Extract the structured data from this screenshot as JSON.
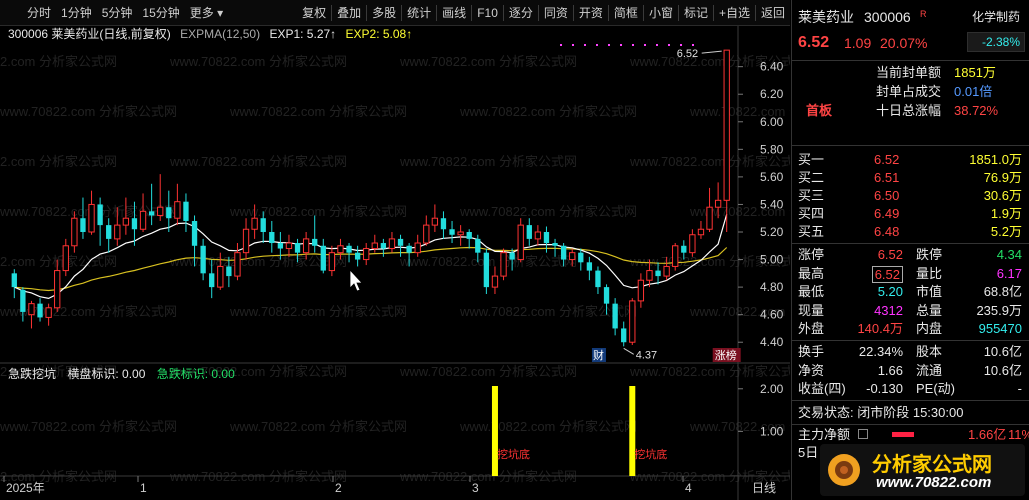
{
  "toolbar": {
    "left": [
      "分时",
      "1分钟",
      "5分钟",
      "15分钟",
      "更多"
    ],
    "right": [
      "复权",
      "叠加",
      "多股",
      "统计",
      "画线",
      "F10",
      "逐分",
      "同资",
      "开资",
      "简框",
      "小窗",
      "标记",
      "+自选",
      "返回"
    ]
  },
  "header": {
    "code_name": "300006 莱美药业(日线,前复权)",
    "indicator": "EXPMA(12,50)",
    "exp1": "EXP1: 5.27↑",
    "exp2": "EXP2: 5.08↑"
  },
  "sub_indicator": {
    "name": "急跌挖坑",
    "label1": "横盘标识: 0.00",
    "label2": "急跌标识: 0.00",
    "marks": [
      "挖坑底",
      "挖坑底"
    ]
  },
  "price_axis": [
    "6.40",
    "6.20",
    "6.00",
    "5.80",
    "5.60",
    "5.40",
    "5.20",
    "5.00",
    "4.80",
    "4.60",
    "4.40"
  ],
  "sub_axis": [
    "2.00",
    "1.00"
  ],
  "x_axis": [
    "2025年",
    "1",
    "2",
    "3",
    "4"
  ],
  "x_axis_right": "日线",
  "annotations": {
    "high": "6.52",
    "low": "4.37",
    "cai": "财",
    "zhangbang": "涨榜"
  },
  "panel": {
    "name": "莱美药业",
    "code": "300006",
    "r_badge": "R",
    "sector": "化学制药",
    "sector_change": "-2.38%",
    "price": "6.52",
    "change": "1.09",
    "pct": "20.07%",
    "tag": "首板",
    "seal_rows": [
      {
        "label": "当前封单额",
        "value": "1851万"
      },
      {
        "label": "封单占成交",
        "value": "0.01倍"
      },
      {
        "label": "十日总涨幅",
        "value": "38.72%"
      }
    ],
    "bids": [
      {
        "label": "买一",
        "price": "6.52",
        "vol": "1851.0万"
      },
      {
        "label": "买二",
        "price": "6.51",
        "vol": "76.9万"
      },
      {
        "label": "买三",
        "price": "6.50",
        "vol": "30.6万"
      },
      {
        "label": "买四",
        "price": "6.49",
        "vol": "1.9万"
      },
      {
        "label": "买五",
        "price": "6.48",
        "vol": "5.2万"
      }
    ],
    "stats": [
      {
        "l1": "涨停",
        "v1": "6.52",
        "l2": "跌停",
        "v2": "4.34"
      },
      {
        "l1": "最高",
        "v1": "6.52",
        "l2": "量比",
        "v2": "6.17"
      },
      {
        "l1": "最低",
        "v1": "5.20",
        "l2": "市值",
        "v2": "68.8亿"
      },
      {
        "l1": "现量",
        "v1": "4312",
        "l2": "总量",
        "v2": "235.9万"
      },
      {
        "l1": "外盘",
        "v1": "140.4万",
        "l2": "内盘",
        "v2": "955470"
      }
    ],
    "stats2": [
      {
        "l1": "换手",
        "v1": "22.34%",
        "l2": "股本",
        "v2": "10.6亿"
      },
      {
        "l1": "净资",
        "v1": "1.66",
        "l2": "流通",
        "v2": "10.6亿"
      },
      {
        "l1": "收益(四)",
        "v1": "-0.130",
        "l2": "PE(动)",
        "v2": "-"
      }
    ],
    "trade_status": "交易状态: 闭市阶段 15:30:00",
    "main_flow_label": "主力净额",
    "main_flow_value": "1.66亿",
    "main_flow_pct": "11%",
    "day5": "5日"
  },
  "watermark": "www.70822.com 分析家公式网",
  "logo": {
    "title": "分析家公式网",
    "url": "www.70822.com"
  },
  "chart_data": {
    "type": "candlestick",
    "title": "300006 莱美药业(日线,前复权)",
    "x_ticks": [
      "2025年",
      "1",
      "2",
      "3",
      "4"
    ],
    "ylim": [
      4.3,
      6.55
    ],
    "candles": [
      [
        4.9,
        4.8,
        4.93,
        4.72
      ],
      [
        4.78,
        4.62,
        4.8,
        4.55
      ],
      [
        4.6,
        4.68,
        4.7,
        4.5
      ],
      [
        4.68,
        4.58,
        4.72,
        4.55
      ],
      [
        4.58,
        4.65,
        4.68,
        4.52
      ],
      [
        4.65,
        4.92,
        5.0,
        4.62
      ],
      [
        4.92,
        5.1,
        5.15,
        4.88
      ],
      [
        5.1,
        5.3,
        5.35,
        5.05
      ],
      [
        5.3,
        5.2,
        5.45,
        5.15
      ],
      [
        5.2,
        5.4,
        5.5,
        5.18
      ],
      [
        5.4,
        5.25,
        5.45,
        5.1
      ],
      [
        5.25,
        5.15,
        5.3,
        5.05
      ],
      [
        5.15,
        5.25,
        5.38,
        5.1
      ],
      [
        5.25,
        5.3,
        5.45,
        5.18
      ],
      [
        5.3,
        5.22,
        5.42,
        5.1
      ],
      [
        5.22,
        5.35,
        5.48,
        5.2
      ],
      [
        5.35,
        5.32,
        5.55,
        5.25
      ],
      [
        5.32,
        5.38,
        5.62,
        5.28
      ],
      [
        5.38,
        5.3,
        5.5,
        5.2
      ],
      [
        5.3,
        5.42,
        5.55,
        5.25
      ],
      [
        5.42,
        5.28,
        5.48,
        5.2
      ],
      [
        5.28,
        5.1,
        5.32,
        4.95
      ],
      [
        5.1,
        4.9,
        5.15,
        4.85
      ],
      [
        4.9,
        4.8,
        5.0,
        4.72
      ],
      [
        4.8,
        4.95,
        5.05,
        4.78
      ],
      [
        4.95,
        4.88,
        5.02,
        4.8
      ],
      [
        4.88,
        5.05,
        5.12,
        4.85
      ],
      [
        5.05,
        5.22,
        5.3,
        5.0
      ],
      [
        5.22,
        5.3,
        5.4,
        5.15
      ],
      [
        5.3,
        5.2,
        5.35,
        5.12
      ],
      [
        5.2,
        5.12,
        5.28,
        5.05
      ],
      [
        5.12,
        5.08,
        5.2,
        5.0
      ],
      [
        5.08,
        5.12,
        5.18,
        5.02
      ],
      [
        5.12,
        5.05,
        5.15,
        4.98
      ],
      [
        5.05,
        5.15,
        5.2,
        5.0
      ],
      [
        5.15,
        5.1,
        5.32,
        5.05
      ],
      [
        5.1,
        4.92,
        5.15,
        4.9
      ],
      [
        4.92,
        5.05,
        5.1,
        4.88
      ],
      [
        5.05,
        5.1,
        5.15,
        5.0
      ],
      [
        5.1,
        5.05,
        5.12,
        4.98
      ],
      [
        5.05,
        5.0,
        5.1,
        4.95
      ],
      [
        5.0,
        5.08,
        5.12,
        4.96
      ],
      [
        5.08,
        5.12,
        5.18,
        5.05
      ],
      [
        5.12,
        5.08,
        5.15,
        5.02
      ],
      [
        5.08,
        5.15,
        5.2,
        5.05
      ],
      [
        5.15,
        5.1,
        5.18,
        5.02
      ],
      [
        5.1,
        5.05,
        5.12,
        4.95
      ],
      [
        5.05,
        5.12,
        5.18,
        5.02
      ],
      [
        5.12,
        5.25,
        5.32,
        5.1
      ],
      [
        5.25,
        5.3,
        5.4,
        5.2
      ],
      [
        5.3,
        5.22,
        5.35,
        5.15
      ],
      [
        5.22,
        5.18,
        5.28,
        5.12
      ],
      [
        5.18,
        5.2,
        5.25,
        5.1
      ],
      [
        5.2,
        5.15,
        5.22,
        5.08
      ],
      [
        5.15,
        5.05,
        5.18,
        4.98
      ],
      [
        5.05,
        4.8,
        5.08,
        4.75
      ],
      [
        4.8,
        4.88,
        4.95,
        4.75
      ],
      [
        4.88,
        5.05,
        5.08,
        4.85
      ],
      [
        5.05,
        5.0,
        5.08,
        4.92
      ],
      [
        5.0,
        5.25,
        5.3,
        4.98
      ],
      [
        5.25,
        5.15,
        5.3,
        5.1
      ],
      [
        5.15,
        5.2,
        5.25,
        5.1
      ],
      [
        5.2,
        5.12,
        5.24,
        5.05
      ],
      [
        5.12,
        5.1,
        5.15,
        5.02
      ],
      [
        5.1,
        5.0,
        5.12,
        4.95
      ],
      [
        5.0,
        5.05,
        5.08,
        4.95
      ],
      [
        5.05,
        4.98,
        5.08,
        4.92
      ],
      [
        4.98,
        4.92,
        5.02,
        4.85
      ],
      [
        4.92,
        4.8,
        4.95,
        4.75
      ],
      [
        4.8,
        4.68,
        4.82,
        4.6
      ],
      [
        4.68,
        4.5,
        4.72,
        4.45
      ],
      [
        4.5,
        4.4,
        4.55,
        4.37
      ],
      [
        4.4,
        4.7,
        4.72,
        4.38
      ],
      [
        4.7,
        4.85,
        4.9,
        4.65
      ],
      [
        4.85,
        4.92,
        5.0,
        4.8
      ],
      [
        4.92,
        4.88,
        4.98,
        4.82
      ],
      [
        4.88,
        4.95,
        5.02,
        4.85
      ],
      [
        4.95,
        5.1,
        5.12,
        4.92
      ],
      [
        5.1,
        5.05,
        5.14,
        5.0
      ],
      [
        5.05,
        5.18,
        5.22,
        5.02
      ],
      [
        5.18,
        5.22,
        5.28,
        5.15
      ],
      [
        5.22,
        5.38,
        5.52,
        5.2
      ],
      [
        5.38,
        5.43,
        5.56,
        5.3
      ],
      [
        5.43,
        6.52,
        6.52,
        5.2
      ]
    ],
    "sub_marks_index": [
      56,
      72
    ]
  }
}
